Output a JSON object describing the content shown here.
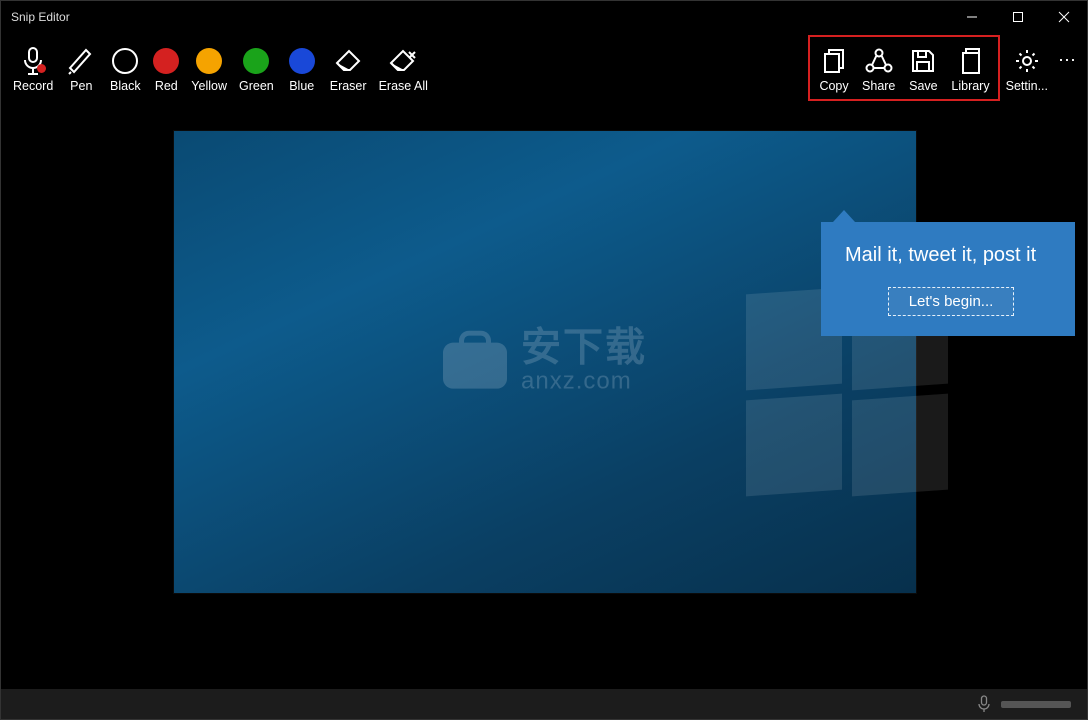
{
  "window": {
    "title": "Snip Editor"
  },
  "toolbar": {
    "record": "Record",
    "pen": "Pen",
    "black": "Black",
    "red": "Red",
    "yellow": "Yellow",
    "green": "Green",
    "blue": "Blue",
    "eraser": "Eraser",
    "erase_all": "Erase All",
    "copy": "Copy",
    "share": "Share",
    "save": "Save",
    "library": "Library",
    "settings": "Settin...",
    "more": "..."
  },
  "colors": {
    "red": "#d42120",
    "yellow": "#f5a300",
    "green": "#1aa31a",
    "blue": "#1948d8"
  },
  "tooltip": {
    "title": "Mail it, tweet it, post it",
    "button": "Let's begin..."
  },
  "watermark": {
    "zh": "安下载",
    "en": "anxz.com"
  }
}
